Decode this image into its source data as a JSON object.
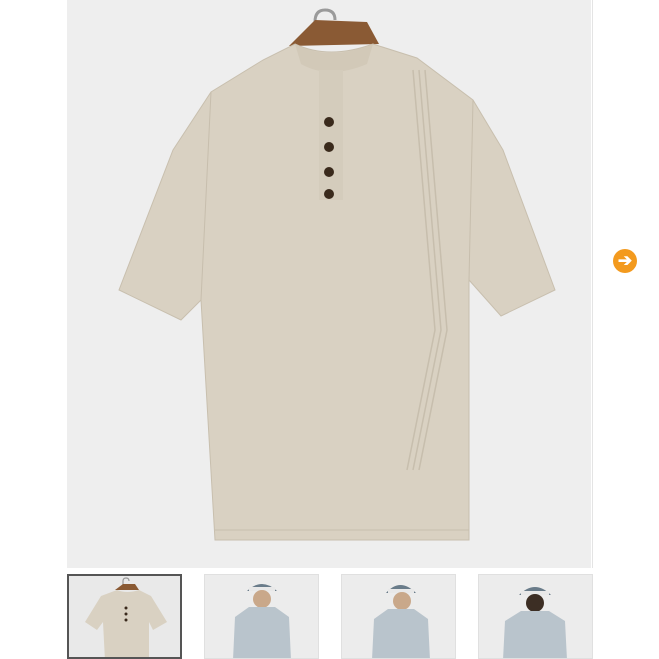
{
  "gallery": {
    "main_image": {
      "icon": "linen-henley-shirt",
      "alt_text": ""
    },
    "next_button": {
      "icon": "arrow-right-icon",
      "glyph": "➔",
      "color": "#f39a1e"
    },
    "thumbnails": [
      {
        "icon": "shirt-on-hanger-thumbnail",
        "selected": true
      },
      {
        "icon": "model-front-thumbnail",
        "selected": false
      },
      {
        "icon": "model-side-thumbnail",
        "selected": false
      },
      {
        "icon": "model-back-thumbnail",
        "selected": false
      }
    ],
    "colors": {
      "shirt": "#d9d1c2",
      "background": "#eeeeee",
      "hanger": "#8a5a34",
      "buttons": "#3a2a1c"
    }
  }
}
